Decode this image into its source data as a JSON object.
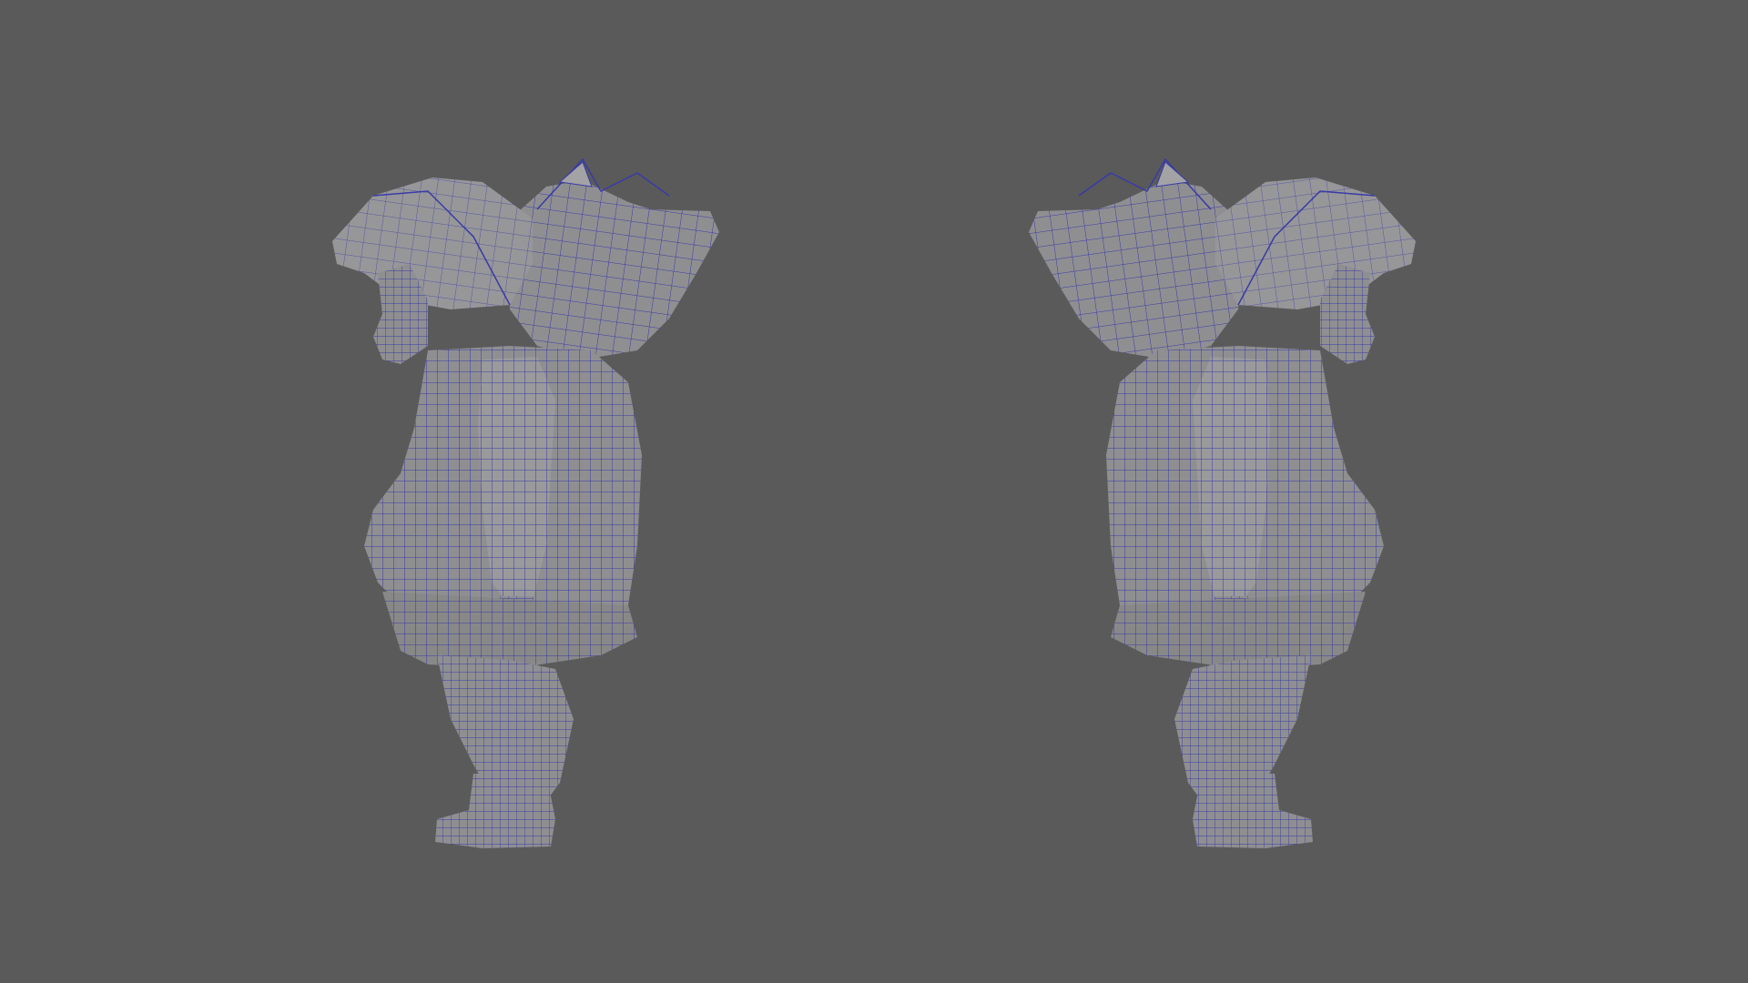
{
  "viewport": {
    "background": "#5a5a5a",
    "mesh_fill": "#8f8f92",
    "mesh_shade": "#7a7a7e",
    "wire_color": "#3a3aa6",
    "views": [
      {
        "name": "side-view-left",
        "facing": "left"
      },
      {
        "name": "side-view-right",
        "facing": "right"
      }
    ]
  }
}
